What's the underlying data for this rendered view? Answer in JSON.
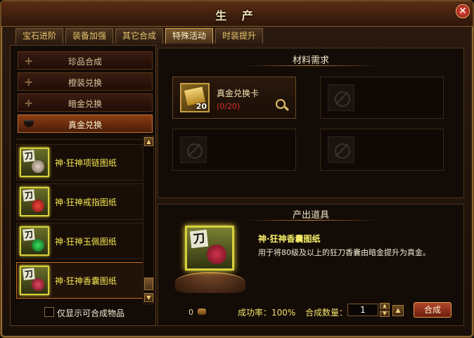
{
  "window": {
    "title": "生 产",
    "close_label": "✕"
  },
  "tabs": [
    {
      "label": "宝石进阶"
    },
    {
      "label": "装备加强"
    },
    {
      "label": "其它合成"
    },
    {
      "label": "特殊活动",
      "active": true
    },
    {
      "label": "时装提升"
    }
  ],
  "categories": [
    {
      "label": "珍品合成"
    },
    {
      "label": "橙装兑换"
    },
    {
      "label": "暗金兑换"
    },
    {
      "label": "真金兑换",
      "open": true
    }
  ],
  "recipes": [
    {
      "name": "神·狂神项链图纸",
      "icon": "necklace-blueprint-icon",
      "glyph": "刀",
      "bag_color": "#c8b0a0"
    },
    {
      "name": "神·狂神戒指图纸",
      "icon": "ring-blueprint-icon",
      "glyph": "刀",
      "bag_color": "#d03030"
    },
    {
      "name": "神·狂神玉佩图纸",
      "icon": "jade-pendant-blueprint-icon",
      "glyph": "刀",
      "bag_color": "#20b040"
    },
    {
      "name": "神·狂神香囊图纸",
      "icon": "sachet-blueprint-icon",
      "glyph": "刀",
      "bag_color": "#c8304a",
      "selected": true
    }
  ],
  "filter": {
    "label": "仅显示可合成物品",
    "checked": false
  },
  "materials": {
    "title": "材料需求",
    "slots": [
      {
        "name": "真金兑换卡",
        "count": "20",
        "progress": "(0/20)",
        "filled": true
      },
      {
        "filled": false
      },
      {
        "filled": false
      },
      {
        "filled": false
      }
    ]
  },
  "output": {
    "title": "产出道具",
    "glyph": "刀",
    "name": "神·狂神香囊图纸",
    "description": "用于将80级及以上的狂刀香囊由暗金提升为真金。"
  },
  "footer": {
    "cost": "0",
    "success_rate": "成功率：100%",
    "qty_label": "合成数量：",
    "qty_value": "1",
    "craft_label": "合成"
  },
  "colors": {
    "accent": "#f4e84e",
    "warning": "#e03030",
    "frame": "#b8863b"
  }
}
